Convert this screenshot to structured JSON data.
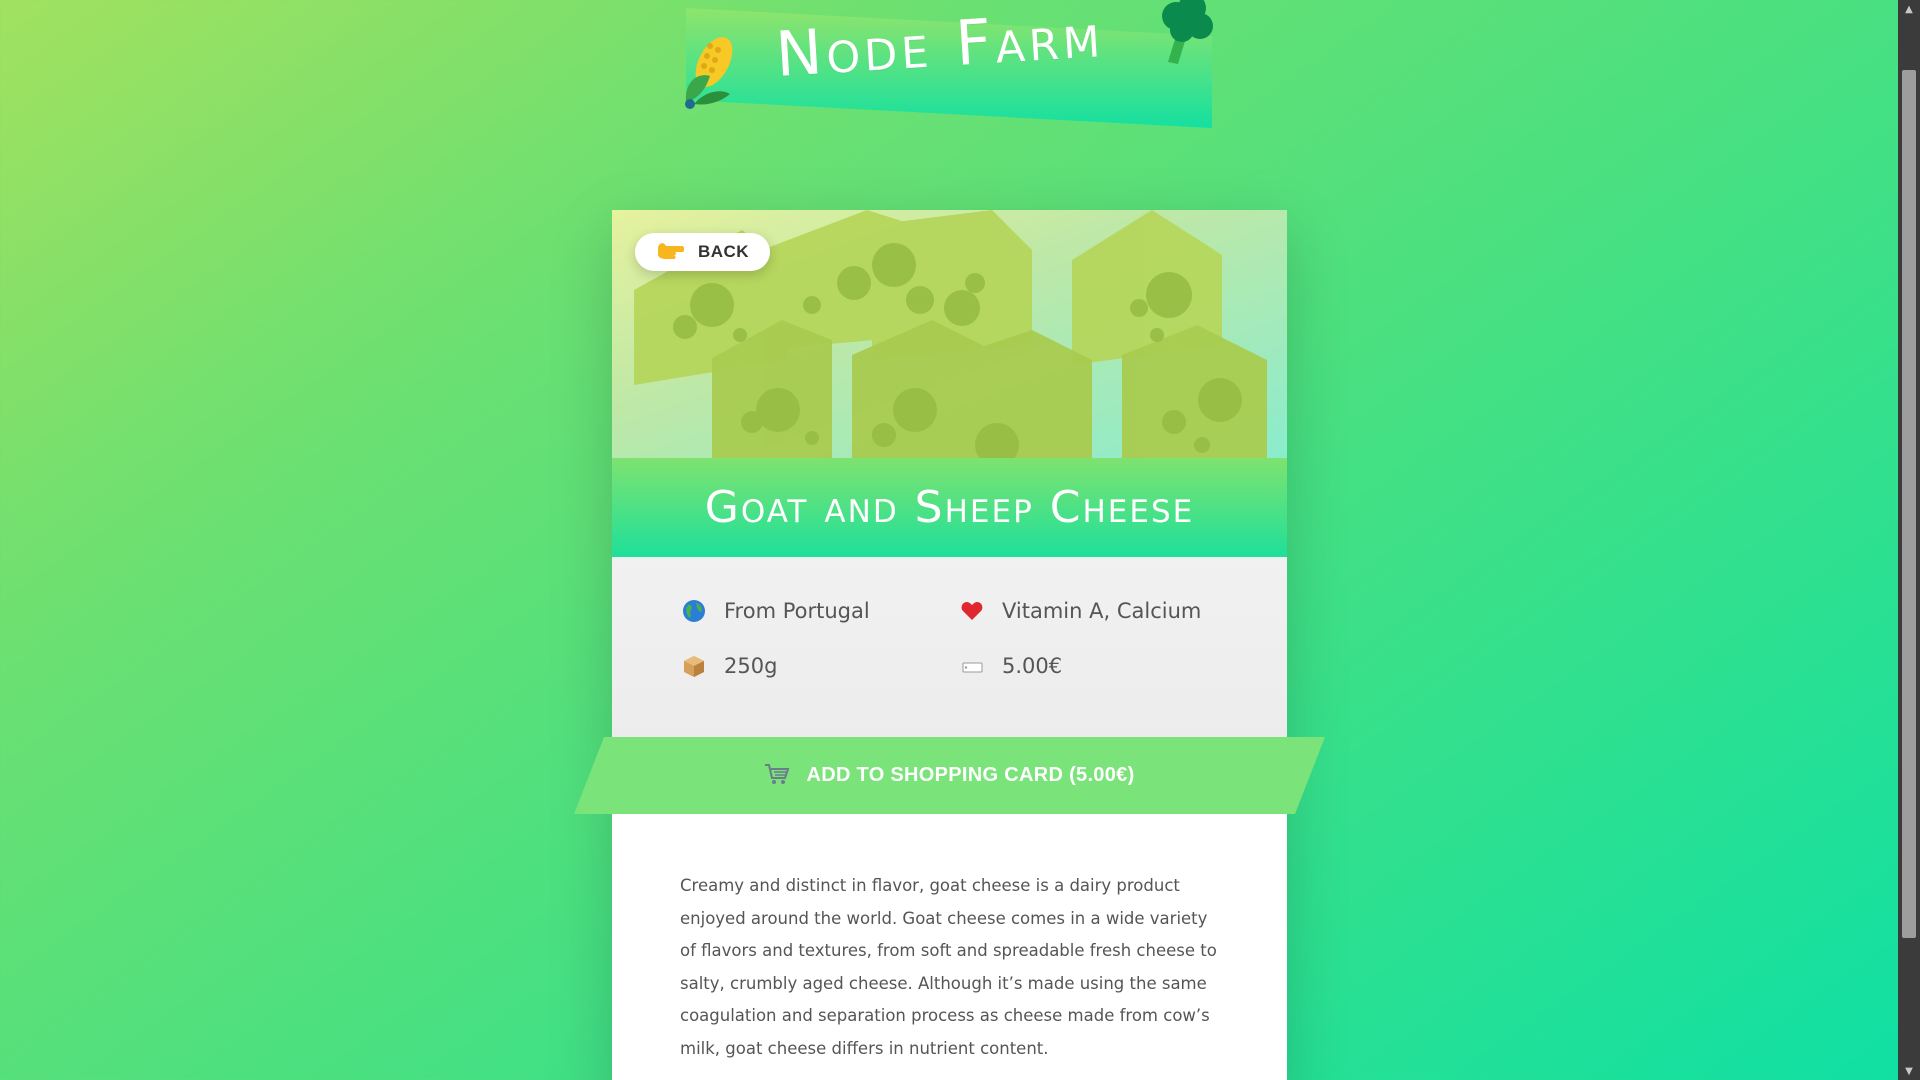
{
  "logo": {
    "text": "Node Farm",
    "left_icon": "corn-icon",
    "right_icon": "broccoli-icon"
  },
  "back_button": {
    "icon": "pointing-hand-icon",
    "label": "BACK"
  },
  "product": {
    "title": "Goat and Sheep Cheese",
    "hero_image": "cheese-pattern",
    "origin": "From Portugal",
    "nutrients": "Vitamin A, Calcium",
    "quantity": "250g",
    "price": "5.00€",
    "description": "Creamy and distinct in flavor, goat cheese is a dairy product enjoyed around the world. Goat cheese comes in a wide variety of flavors and textures, from soft and spreadable fresh cheese to salty, crumbly aged cheese. Although it’s made using the same coagulation and separation process as cheese made from cow’s milk, goat cheese differs in nutrient content."
  },
  "info_icons": {
    "origin": "globe-icon",
    "nutrients": "heart-icon",
    "quantity": "package-icon",
    "price": "price-tag-icon"
  },
  "cta": {
    "icon": "shopping-cart-icon",
    "label": "ADD TO SHOPPING CARD (5.00€)"
  },
  "colors": {
    "brand_green": "#7ee270",
    "brand_teal": "#1ee09a",
    "text_gray": "#555555"
  }
}
